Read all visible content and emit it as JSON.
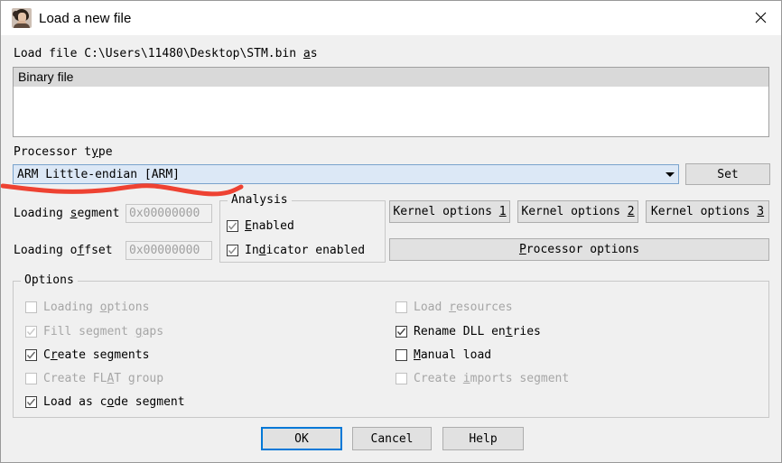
{
  "window": {
    "title": "Load a new file",
    "icon": "ida-portrait-icon",
    "close_label": "✕"
  },
  "load_file": {
    "prefix": "Load file ",
    "path": "C:\\Users\\11480\\Desktop\\STM.bin",
    "suffix_pre": " ",
    "suffix_accel": "a",
    "suffix_post": "s"
  },
  "file_types": {
    "items": [
      {
        "label": "Binary file",
        "selected": true
      }
    ]
  },
  "processor": {
    "label_pre": "Processor t",
    "label_accel": "y",
    "label_post": "pe",
    "selected": "ARM Little-endian [ARM]",
    "set_button": "Set"
  },
  "loading": {
    "segment": {
      "label_pre": "Loading ",
      "label_accel": "s",
      "label_post": "egment",
      "value": "0x00000000",
      "enabled": false
    },
    "offset": {
      "label_pre": "Loading o",
      "label_accel": "f",
      "label_post": "fset",
      "value": "0x00000000",
      "enabled": false
    }
  },
  "analysis": {
    "legend": "Analysis",
    "checkboxes": [
      {
        "label_pre": "",
        "label_accel": "E",
        "label_post": "nabled",
        "checked": true,
        "enabled": true
      },
      {
        "label_pre": "In",
        "label_accel": "d",
        "label_post": "icator enabled",
        "checked": true,
        "enabled": true
      }
    ]
  },
  "kernel_buttons": [
    {
      "pre": "Kernel options ",
      "accel": "1",
      "post": ""
    },
    {
      "pre": "Kernel options ",
      "accel": "2",
      "post": ""
    },
    {
      "pre": "Kernel options ",
      "accel": "3",
      "post": ""
    }
  ],
  "processor_options_button": {
    "pre": "",
    "accel": "P",
    "post": "rocessor options"
  },
  "options": {
    "legend": "Options",
    "left_column": [
      {
        "name": "loading-options",
        "pre": "Loading ",
        "accel": "o",
        "post": "ptions",
        "checked": false,
        "enabled": false
      },
      {
        "name": "fill-segment-gaps",
        "pre": "Fill segment ",
        "accel": "g",
        "post": "aps",
        "checked": true,
        "enabled": false
      },
      {
        "name": "create-segments",
        "pre": "C",
        "accel": "r",
        "post": "eate segments",
        "checked": true,
        "enabled": true
      },
      {
        "name": "create-flat-group",
        "pre": "Create FL",
        "accel": "A",
        "post": "T group",
        "checked": false,
        "enabled": false
      },
      {
        "name": "load-as-code-segment",
        "pre": "Load as c",
        "accel": "o",
        "post": "de segment",
        "checked": true,
        "enabled": true
      }
    ],
    "right_column": [
      {
        "name": "load-resources",
        "pre": "Load ",
        "accel": "r",
        "post": "esources",
        "checked": false,
        "enabled": false
      },
      {
        "name": "rename-dll-entries",
        "pre": "Rename DLL en",
        "accel": "t",
        "post": "ries",
        "checked": true,
        "enabled": true
      },
      {
        "name": "manual-load",
        "pre": "",
        "accel": "M",
        "post": "anual load",
        "checked": false,
        "enabled": true
      },
      {
        "name": "create-imports-segment",
        "pre": "Create ",
        "accel": "i",
        "post": "mports segment",
        "checked": false,
        "enabled": false
      }
    ]
  },
  "buttons": {
    "ok": "OK",
    "cancel": "Cancel",
    "help": "Help"
  },
  "annotation": {
    "type": "hand-drawn-red-underline",
    "color": "#ee3322"
  },
  "colors": {
    "dialog_bg": "#f0f0f0",
    "button_face": "#e1e1e1",
    "focus_blue": "#0078d7",
    "combo_bg": "#dce8f6",
    "selection_gray": "#d9d9d9",
    "disabled_text": "#a6a6a6"
  }
}
